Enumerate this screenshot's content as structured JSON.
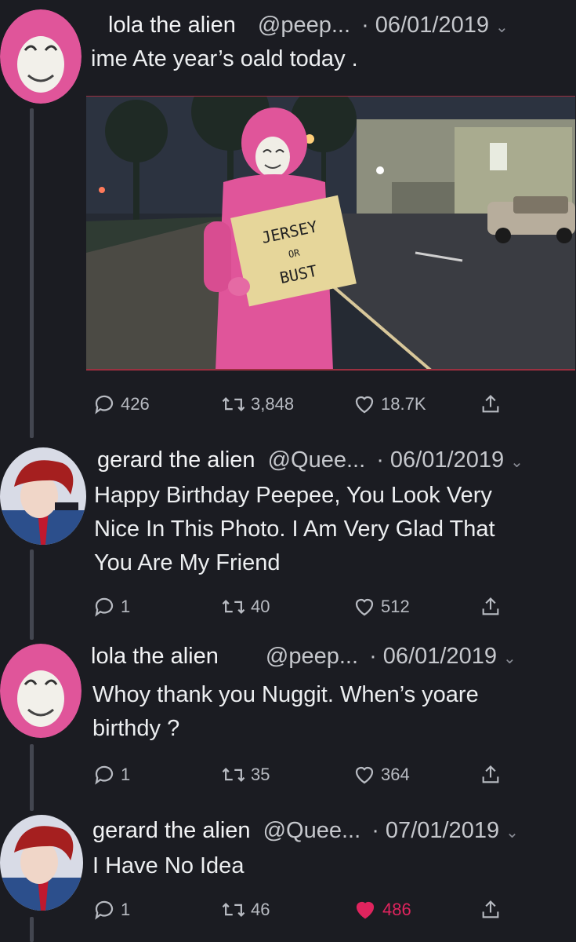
{
  "tweets": [
    {
      "name": "lola the alien",
      "handle": "@peep...",
      "date": "· 06/01/2019",
      "text": "ime Ate year’s oald today .",
      "image": {
        "sign_lines": [
          "JERSEY",
          "OR",
          "BUST"
        ]
      },
      "replies": "426",
      "retweets": "3,848",
      "likes": "18.7K",
      "liked": false
    },
    {
      "name": "gerard the alien",
      "handle": "@Quee...",
      "date": "· 06/01/2019",
      "text_lines": [
        "Happy Birthday Peepee, You Look Very",
        "Nice In This Photo. I Am Very Glad That",
        "You Are My Friend"
      ],
      "replies": "1",
      "retweets": "40",
      "likes": "512",
      "liked": false
    },
    {
      "name": "lola the alien",
      "handle": "@peep...",
      "date": "· 06/01/2019",
      "text_lines": [
        "Whoy thank you Nuggit. When’s yoare",
        "birthdy ?"
      ],
      "replies": "1",
      "retweets": "35",
      "likes": "364",
      "liked": false
    },
    {
      "name": "gerard the alien",
      "handle": "@Quee...",
      "date": "· 07/01/2019",
      "text": "I Have No Idea",
      "replies": "1",
      "retweets": "46",
      "likes": "486",
      "liked": true
    }
  ],
  "icons": {
    "reply": "reply-bubble-icon",
    "retweet": "retweet-icon",
    "like": "heart-icon",
    "share": "share-icon",
    "more": "chevron-down-icon"
  },
  "colors": {
    "background": "#1b1c22",
    "liked": "#e0245e",
    "muted_text": "#b8bbc2",
    "pink_suit": "#e0559a"
  }
}
